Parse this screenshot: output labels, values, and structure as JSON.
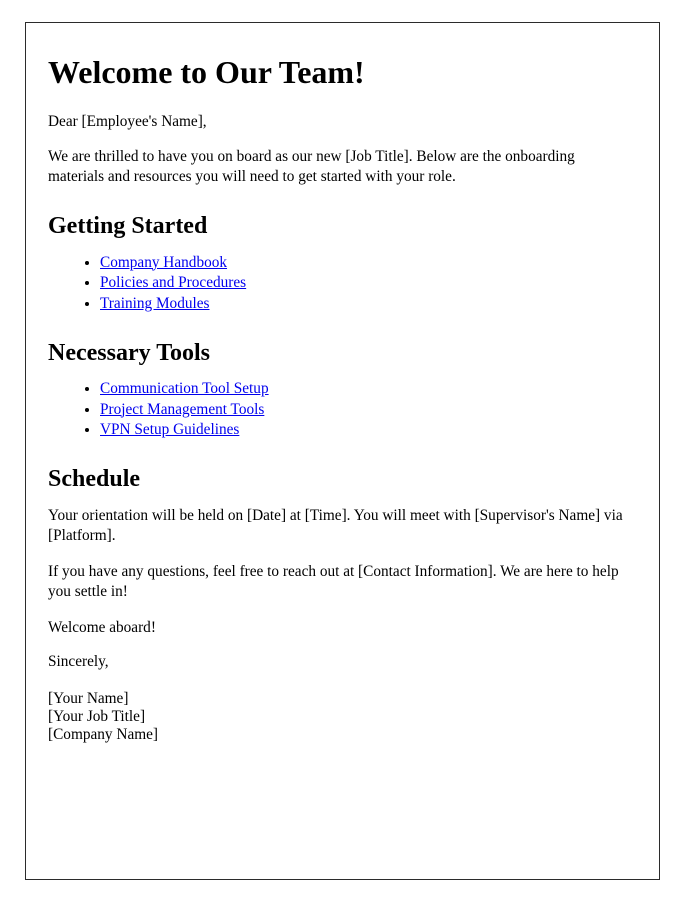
{
  "document": {
    "title": "Welcome to Our Team!",
    "salutation": "Dear [Employee's Name],",
    "intro_paragraph": "We are thrilled to have you on board as our new [Job Title]. Below are the onboarding materials and resources you will need to get started with your role.",
    "sections": [
      {
        "heading": "Getting Started",
        "links": [
          {
            "label": "Company Handbook"
          },
          {
            "label": "Policies and Procedures"
          },
          {
            "label": "Training Modules"
          }
        ]
      },
      {
        "heading": "Necessary Tools",
        "links": [
          {
            "label": "Communication Tool Setup"
          },
          {
            "label": "Project Management Tools"
          },
          {
            "label": "VPN Setup Guidelines"
          }
        ]
      },
      {
        "heading": "Schedule"
      }
    ],
    "schedule_paragraph": "Your orientation will be held on [Date] at [Time]. You will meet with [Supervisor's Name] via [Platform].",
    "questions_paragraph": "If you have any questions, feel free to reach out at [Contact Information]. We are here to help you settle in!",
    "welcome_line": "Welcome aboard!",
    "closing_line": "Sincerely,",
    "signature": {
      "name": "[Your Name]",
      "job_title": "[Your Job Title]",
      "company": "[Company Name]"
    }
  },
  "colors": {
    "link": "#0000EE",
    "border": "#2B2B2B",
    "text": "#000000",
    "background": "#FFFFFF"
  }
}
